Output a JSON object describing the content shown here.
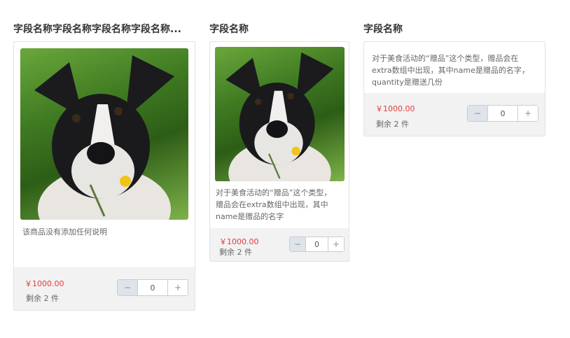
{
  "columns": [
    {
      "title": "字段名称字段名称字段名称字段名称...",
      "description": "该商品没有添加任何说明",
      "price": "￥1000.00",
      "stock": "剩余 2 件",
      "quantity": "0",
      "minus": "−",
      "plus": "+"
    },
    {
      "title": "字段名称",
      "description_lines": [
        "对于美食活动的“赠品”这个类型，",
        "赠品会在extra数组中出现，其中",
        "name是赠品的名字"
      ],
      "price": "￥1000.00",
      "stock": "剩余 2 件",
      "quantity": "0",
      "minus": "−",
      "plus": "+"
    },
    {
      "title": "字段名称",
      "description_lines": [
        "对于美食活动的“赠品”这个类型，赠品会在",
        "extra数组中出现，其中name是赠品的名字，",
        "quantity是赠送几份"
      ],
      "price": "￥1000.00",
      "stock": "剩余 2 件",
      "quantity": "0",
      "minus": "−",
      "plus": "+"
    }
  ],
  "colors": {
    "price": "#e4393c",
    "footer_bg": "#f2f2f2",
    "stepper_minus_bg": "#dfe3ea"
  }
}
